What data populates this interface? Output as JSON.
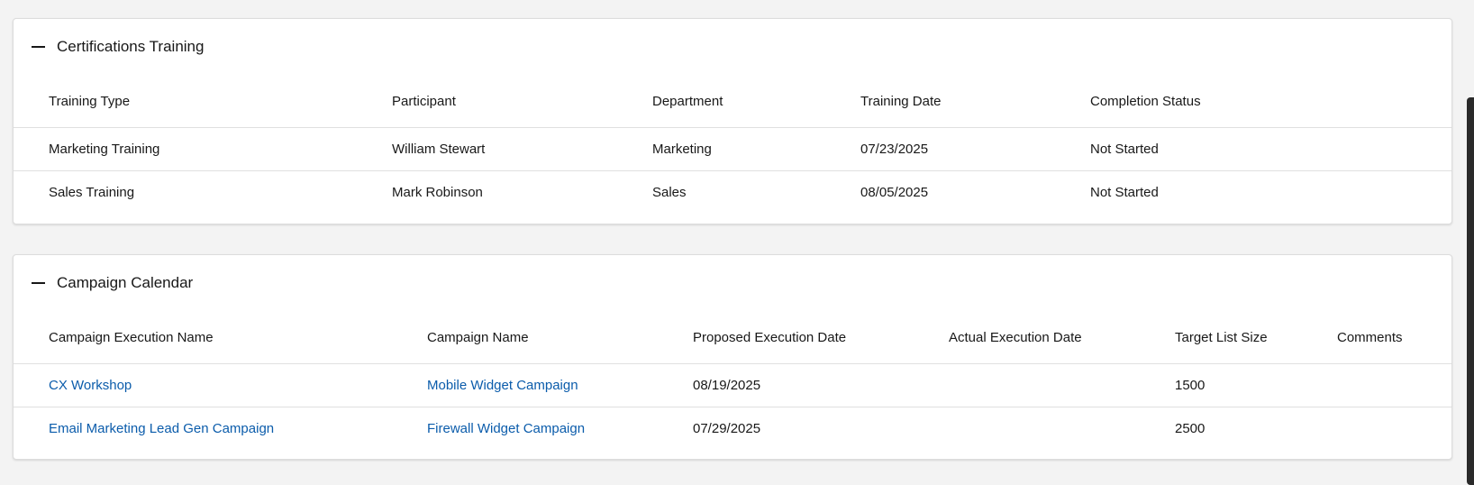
{
  "certifications": {
    "title": "Certifications Training",
    "columns": [
      "Training Type",
      "Participant",
      "Department",
      "Training Date",
      "Completion Status"
    ],
    "rows": [
      [
        "Marketing Training",
        "William Stewart",
        "Marketing",
        "07/23/2025",
        "Not Started"
      ],
      [
        "Sales Training",
        "Mark Robinson",
        "Sales",
        "08/05/2025",
        "Not Started"
      ]
    ]
  },
  "campaign": {
    "title": "Campaign Calendar",
    "columns": [
      "Campaign Execution Name",
      "Campaign Name",
      "Proposed Execution Date",
      "Actual Execution Date",
      "Target List Size",
      "Comments"
    ],
    "rows": [
      [
        "CX Workshop",
        "Mobile Widget Campaign",
        "08/19/2025",
        "",
        "1500",
        ""
      ],
      [
        "Email Marketing Lead Gen Campaign",
        "Firewall Widget Campaign",
        "07/29/2025",
        "",
        "2500",
        ""
      ]
    ]
  },
  "colors": {
    "link": "#0b5cab",
    "text": "#181818",
    "background": "#f3f3f3"
  }
}
